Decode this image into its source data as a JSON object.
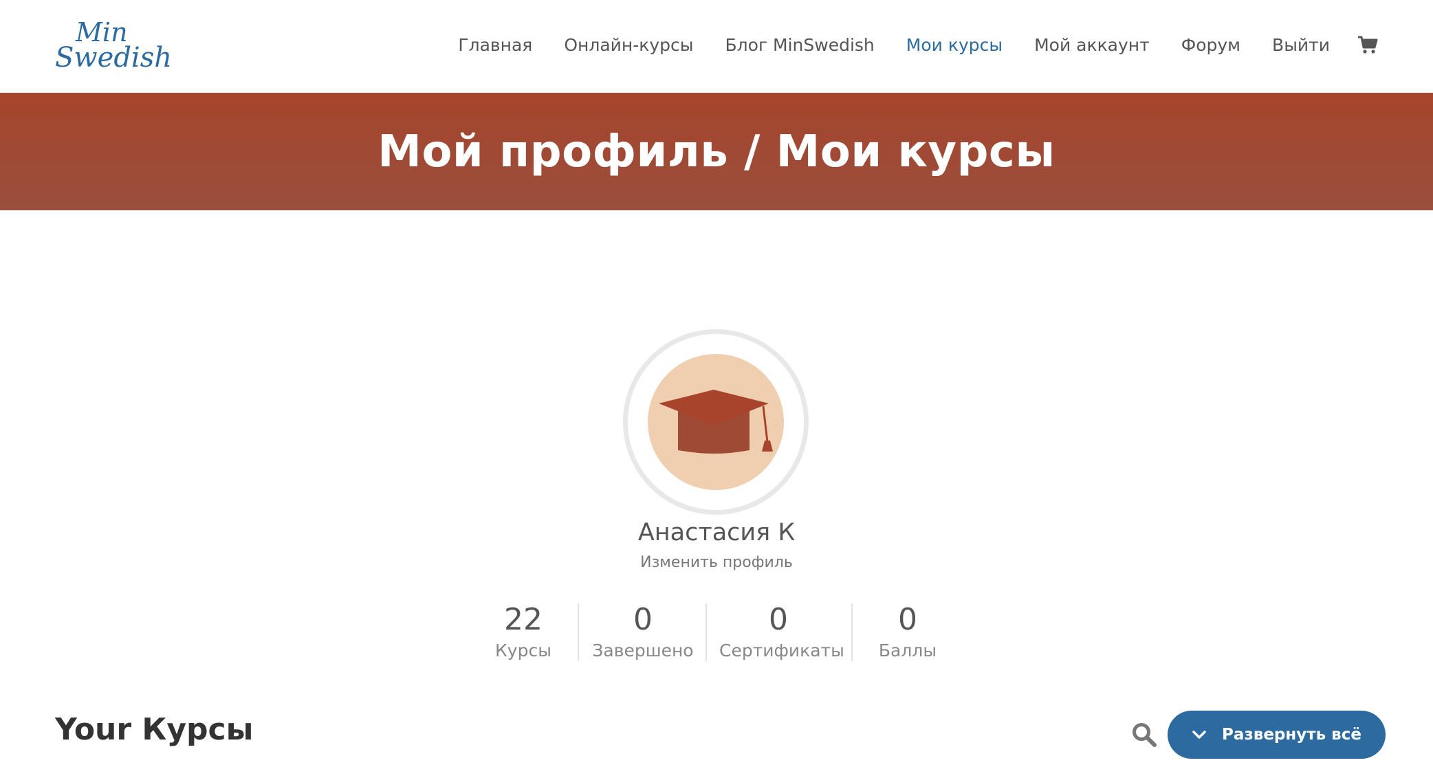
{
  "logo": {
    "line1": "Min",
    "line2": "Swedish"
  },
  "nav": {
    "items": [
      {
        "label": "Главная",
        "active": false
      },
      {
        "label": "Онлайн-курсы",
        "active": false
      },
      {
        "label": "Блог MinSwedish",
        "active": false
      },
      {
        "label": "Мои курсы",
        "active": true
      },
      {
        "label": "Мой аккаунт",
        "active": false
      },
      {
        "label": "Форум",
        "active": false
      },
      {
        "label": "Выйти",
        "active": false
      }
    ],
    "cart_icon": "shopping-cart-icon"
  },
  "banner": {
    "title": "Мой профиль / Мои курсы"
  },
  "profile": {
    "avatar_icon": "graduation-cap-icon",
    "name": "Анастасия К",
    "edit_link": "Изменить профиль",
    "stats": [
      {
        "value": "22",
        "label": "Курсы"
      },
      {
        "value": "0",
        "label": "Завершено"
      },
      {
        "value": "0",
        "label": "Сертификаты"
      },
      {
        "value": "0",
        "label": "Баллы"
      }
    ]
  },
  "courses": {
    "title": "Your Курсы",
    "search_icon": "search-icon",
    "expand_all": "Развернуть всё"
  },
  "colors": {
    "accent": "#2c6aa0",
    "banner": "#a6452c",
    "avatar_bg": "#f0cfb1",
    "cap": "#9e4a35"
  }
}
